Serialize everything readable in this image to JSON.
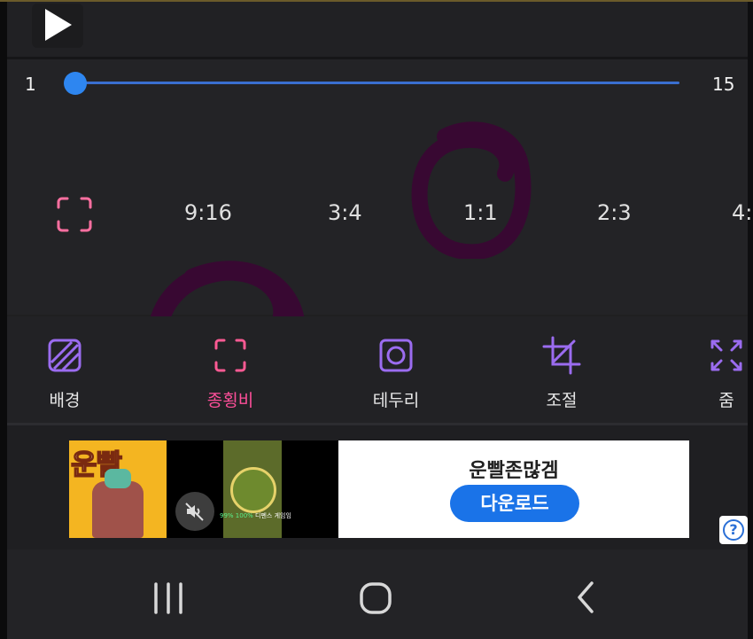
{
  "player": {
    "play_icon": "play-icon"
  },
  "slider": {
    "min_label": "1",
    "max_label": "15",
    "value": 1,
    "range": [
      1,
      15
    ],
    "color": "#2e86f0"
  },
  "aspect_ratios": {
    "free_icon": "free-crop-icon",
    "options": [
      {
        "label": "9:16"
      },
      {
        "label": "3:4"
      },
      {
        "label": "1:1"
      },
      {
        "label": "2:3"
      },
      {
        "label": "4:"
      }
    ]
  },
  "toolbar": {
    "items": [
      {
        "label": "배경",
        "icon": "background-icon"
      },
      {
        "label": "종횡비",
        "icon": "aspect-ratio-icon",
        "active": true
      },
      {
        "label": "테두리",
        "icon": "border-icon"
      },
      {
        "label": "조절",
        "icon": "crop-adjust-icon"
      },
      {
        "label": "줌",
        "icon": "zoom-icon"
      }
    ],
    "active_color": "#ff4f9a",
    "icon_color": "#9b6cf0"
  },
  "ad": {
    "game_art_title": "운빨",
    "caption_highlight": "99% 100%",
    "caption_text": "디펜스 게임임",
    "headline": "운빨존많겜",
    "cta_label": "다운로드",
    "cta_color": "#1a73e8",
    "mute_icon": "mute-icon",
    "info_icon": "help-icon",
    "info_glyph": "?"
  },
  "system_nav": {
    "recents_icon": "recents-icon",
    "home_icon": "home-icon",
    "back_icon": "back-icon"
  },
  "annotation_color": "#3a0733"
}
